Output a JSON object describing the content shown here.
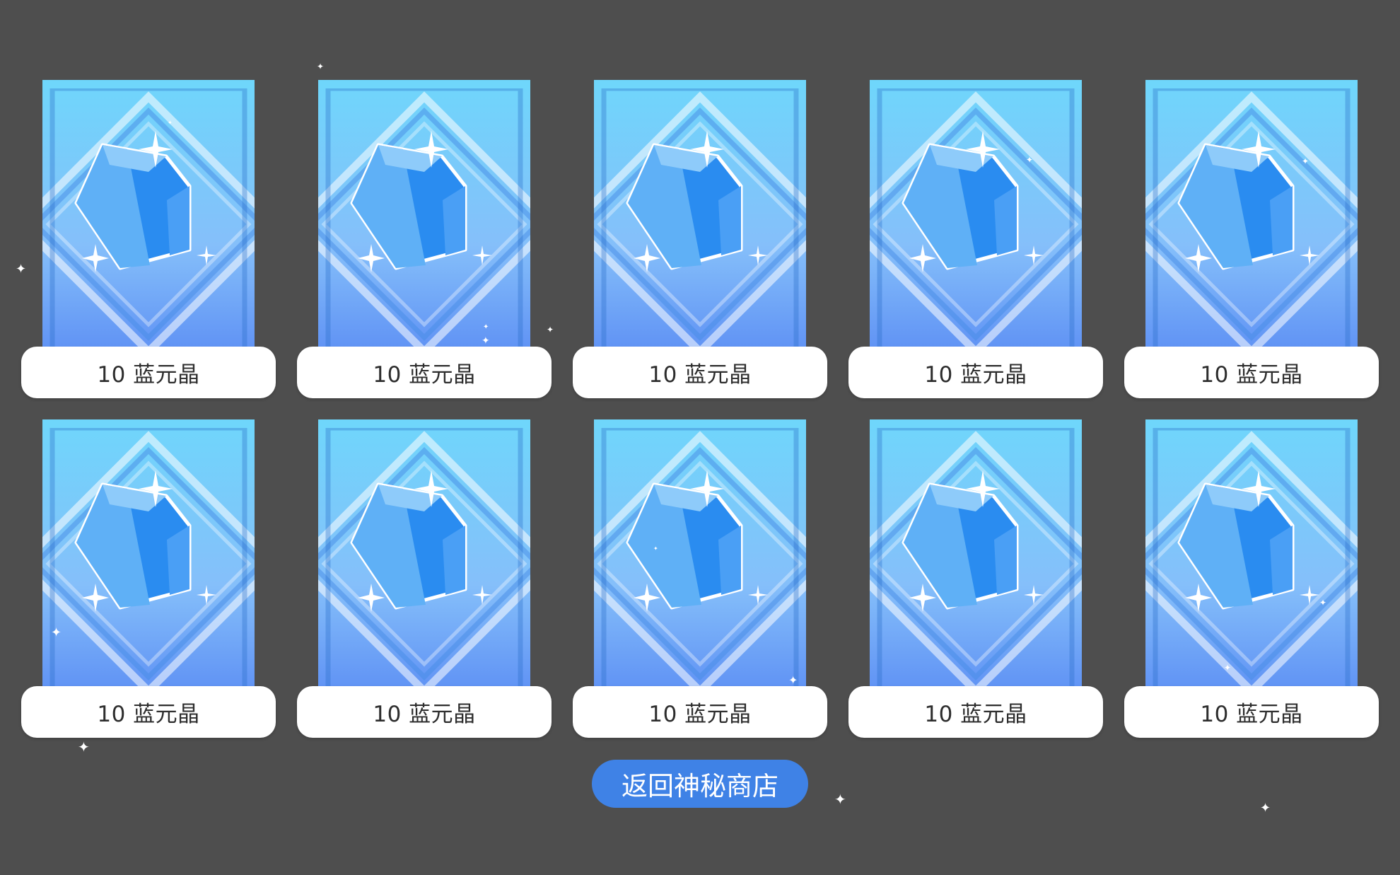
{
  "rewards": [
    {
      "label": "10 蓝元晶",
      "item_icon": "blue-crystal-icon"
    },
    {
      "label": "10 蓝元晶",
      "item_icon": "blue-crystal-icon"
    },
    {
      "label": "10 蓝元晶",
      "item_icon": "blue-crystal-icon"
    },
    {
      "label": "10 蓝元晶",
      "item_icon": "blue-crystal-icon"
    },
    {
      "label": "10 蓝元晶",
      "item_icon": "blue-crystal-icon"
    },
    {
      "label": "10 蓝元晶",
      "item_icon": "blue-crystal-icon"
    },
    {
      "label": "10 蓝元晶",
      "item_icon": "blue-crystal-icon"
    },
    {
      "label": "10 蓝元晶",
      "item_icon": "blue-crystal-icon"
    },
    {
      "label": "10 蓝元晶",
      "item_icon": "blue-crystal-icon"
    },
    {
      "label": "10 蓝元晶",
      "item_icon": "blue-crystal-icon"
    }
  ],
  "back_button": {
    "label": "返回神秘商店"
  },
  "colors": {
    "background": "#4e4e4e",
    "card_top": "#6fd6fb",
    "card_bottom": "#5e90f4",
    "crystal": "#2a8cf0",
    "button": "#3f82e6"
  }
}
